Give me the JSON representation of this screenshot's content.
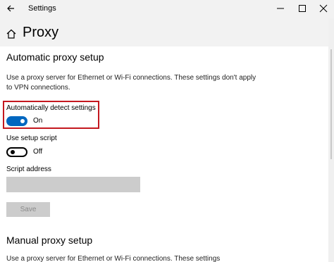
{
  "window": {
    "title": "Settings"
  },
  "page": {
    "title": "Proxy"
  },
  "automatic": {
    "heading": "Automatic proxy setup",
    "description": "Use a proxy server for Ethernet or Wi-Fi connections. These settings don't apply to VPN connections.",
    "detect_label": "Automatically detect settings",
    "detect_state": "On",
    "script_label": "Use setup script",
    "script_state": "Off",
    "address_label": "Script address",
    "address_value": "",
    "save_label": "Save"
  },
  "manual": {
    "heading": "Manual proxy setup",
    "description": "Use a proxy server for Ethernet or Wi-Fi connections. These settings"
  },
  "colors": {
    "accent": "#0067c0",
    "highlight_box": "#c4181f"
  },
  "icons": [
    "back-arrow-icon",
    "minimize-icon",
    "maximize-icon",
    "close-icon",
    "home-icon"
  ]
}
